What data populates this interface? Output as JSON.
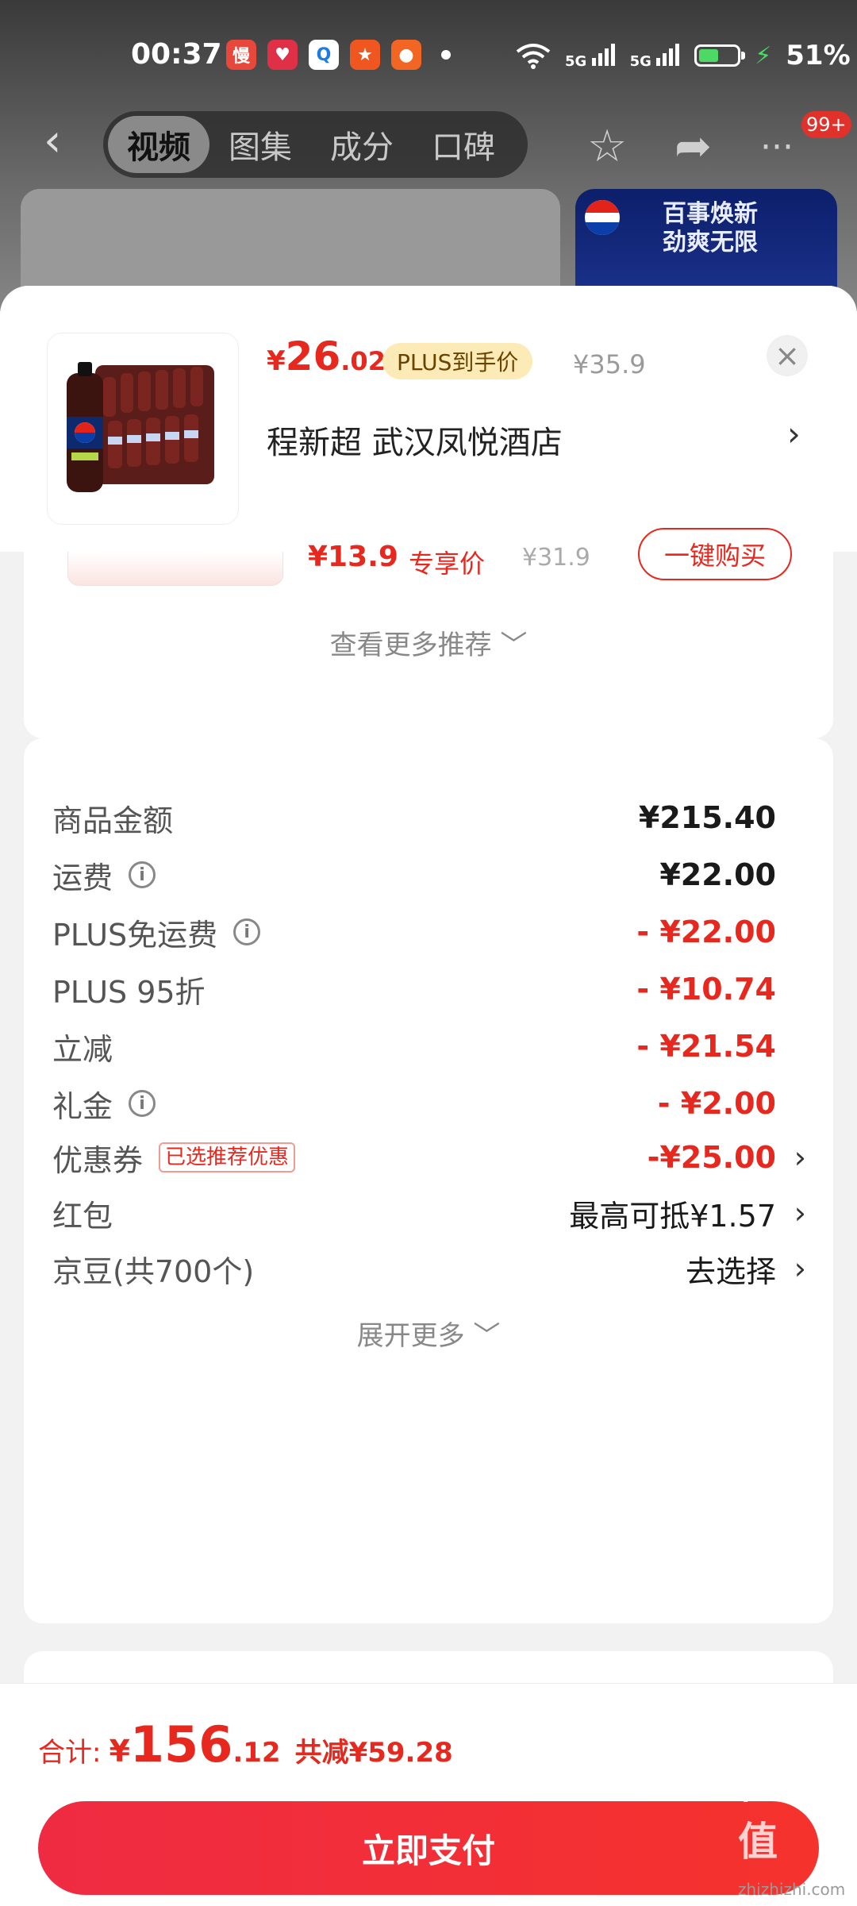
{
  "status_bar": {
    "time": "00:37",
    "network": "5G",
    "battery": "51%",
    "app_icons": [
      {
        "name": "slow-app-icon",
        "label": "慢",
        "color": "#e8473c"
      },
      {
        "name": "heart-app-icon",
        "label": "♥",
        "color": "#e03048"
      },
      {
        "name": "search-app-icon",
        "label": "Q",
        "color": "#ffffff"
      },
      {
        "name": "game-app-icon",
        "label": "★",
        "color": "#f0561f"
      },
      {
        "name": "mascot-app-icon",
        "label": "●",
        "color": "#f26522"
      }
    ]
  },
  "nav": {
    "tabs": [
      "视频",
      "图集",
      "成分",
      "口碑"
    ],
    "active_tab": 0,
    "badge": "99+"
  },
  "banner": {
    "text": "百事焕新\n劲爽无限",
    "brand": "PEPSI"
  },
  "sheet": {
    "price_symbol": "¥",
    "price_int": "26",
    "price_dec": ".02",
    "price_tag": "PLUS到手价",
    "original_price": "¥35.9",
    "address": "程新超  武汉凤悦酒店",
    "recommendation": {
      "price": "¥13.9",
      "tag": "专享价",
      "original": "¥31.9",
      "buy_button": "一键购买",
      "more": "查看更多推荐"
    }
  },
  "summary": {
    "rows": [
      {
        "label": "商品金额",
        "value": "¥215.40",
        "info": false,
        "style": "normal"
      },
      {
        "label": "运费",
        "value": "¥22.00",
        "info": true,
        "style": "normal"
      },
      {
        "label": "PLUS免运费",
        "value": "- ¥22.00",
        "info": true,
        "style": "red"
      },
      {
        "label": "PLUS 95折",
        "value": "- ¥10.74",
        "info": false,
        "style": "red"
      },
      {
        "label": "立减",
        "value": "- ¥21.54",
        "info": false,
        "style": "red"
      },
      {
        "label": "礼金",
        "value": "- ¥2.00",
        "info": true,
        "style": "red"
      }
    ],
    "coupon": {
      "label": "优惠券",
      "badge": "已选推荐优惠",
      "value": "-¥25.00"
    },
    "red_packet": {
      "label": "红包",
      "value": "最高可抵¥1.57"
    },
    "jd_beans": {
      "label": "京豆(共700个)",
      "value": "去选择"
    },
    "expand": "展开更多"
  },
  "bottom": {
    "total_label": "合计:",
    "total_yen": "¥",
    "total_int": "156",
    "total_dec": ".12",
    "savings": "共减¥59.28",
    "pay_button": "立即支付",
    "watermark": "值值值",
    "watermark_url": "zhizhizhi.com"
  },
  "colors": {
    "accent": "#e6281e",
    "plus_tag_bg": "#fdebb7",
    "pay_gradient_start": "#ef2b43"
  }
}
